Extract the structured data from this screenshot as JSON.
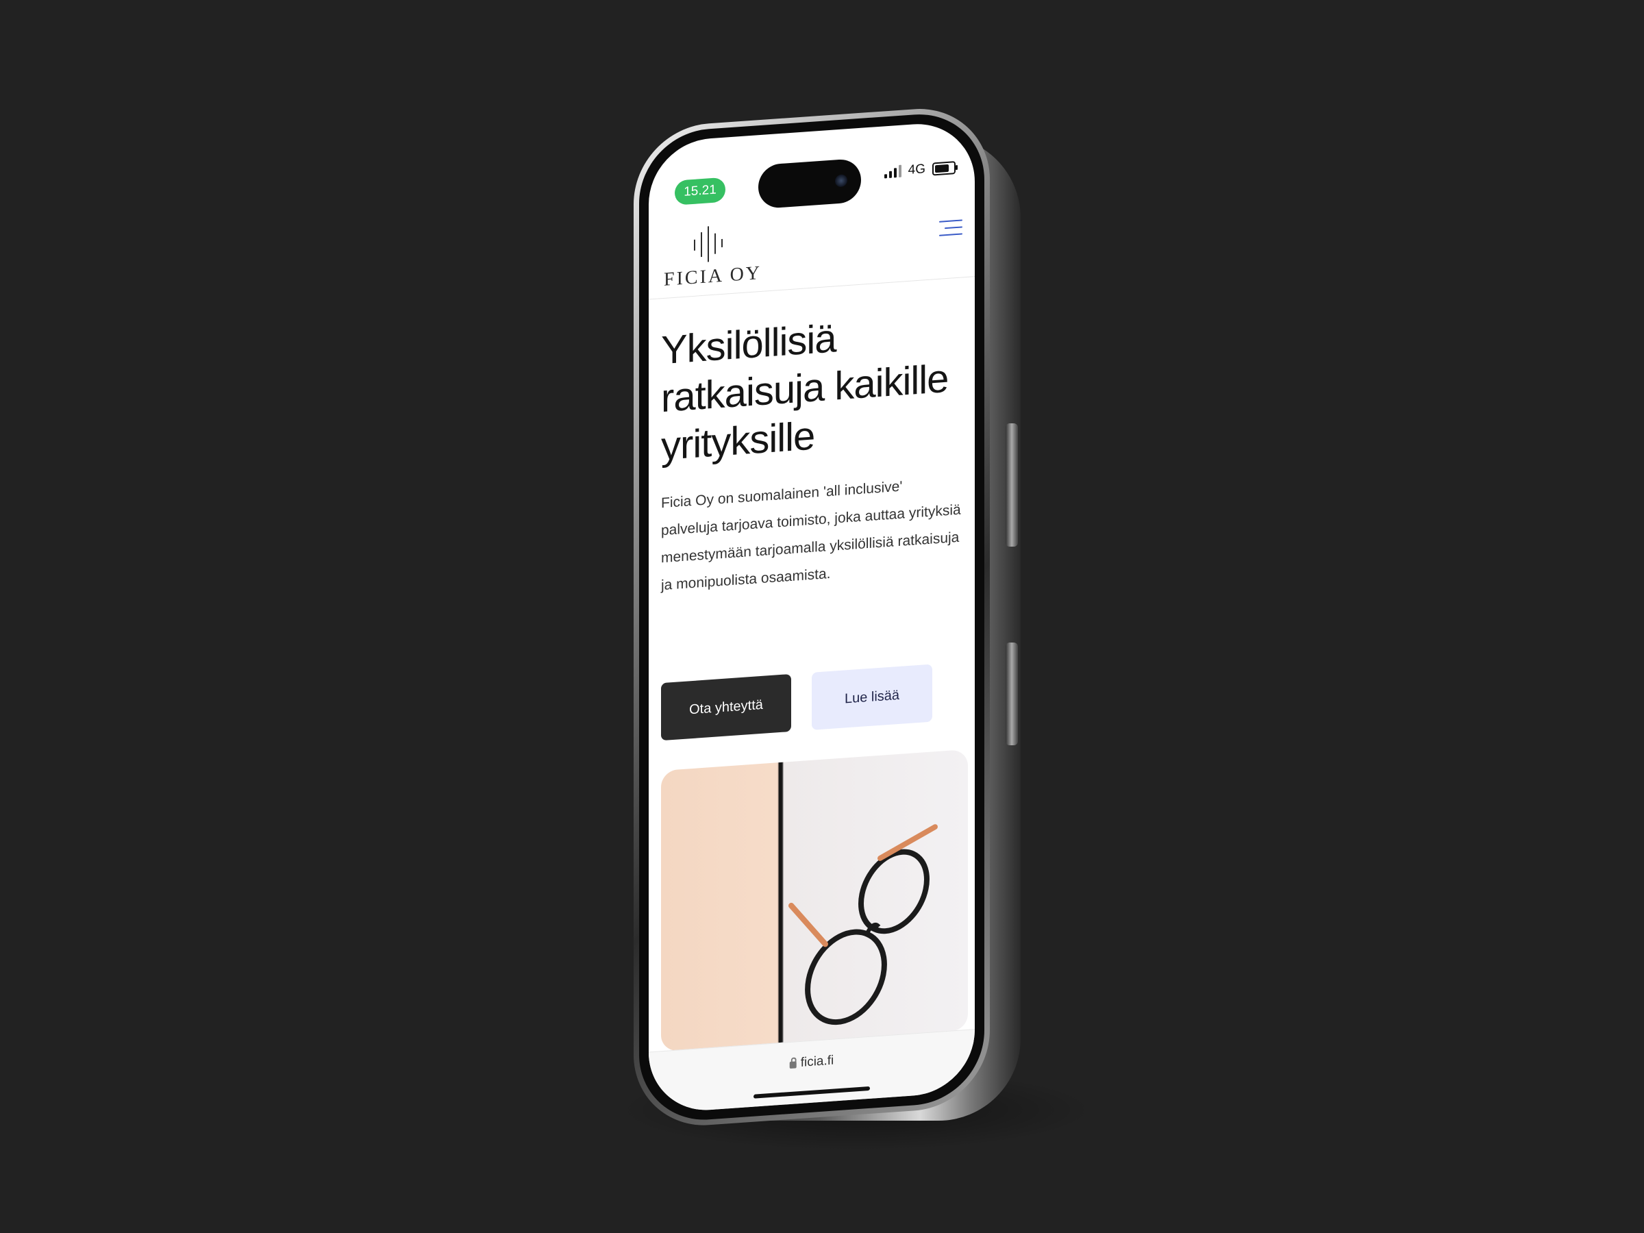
{
  "status_bar": {
    "time": "15.21",
    "network": "4G"
  },
  "header": {
    "logo_text": "FICIA OY"
  },
  "hero": {
    "title": "Yksilöllisiä ratkaisuja kaikille yrityksille",
    "text": "Ficia Oy on suomalainen 'all inclusive' palveluja tarjoava toimisto, joka auttaa yrityksiä menestymään tarjoamalla yksilöllisiä ratkaisuja ja monipuolista osaamista.",
    "primary_button": "Ota yhteyttä",
    "secondary_button": "Lue lisää"
  },
  "browser": {
    "url": "ficia.fi"
  },
  "colors": {
    "background": "#222222",
    "status_pill": "#36c062",
    "primary_button": "#2b2b2b",
    "secondary_button": "#e8ebfd",
    "menu_icon": "#3a5bc7"
  }
}
